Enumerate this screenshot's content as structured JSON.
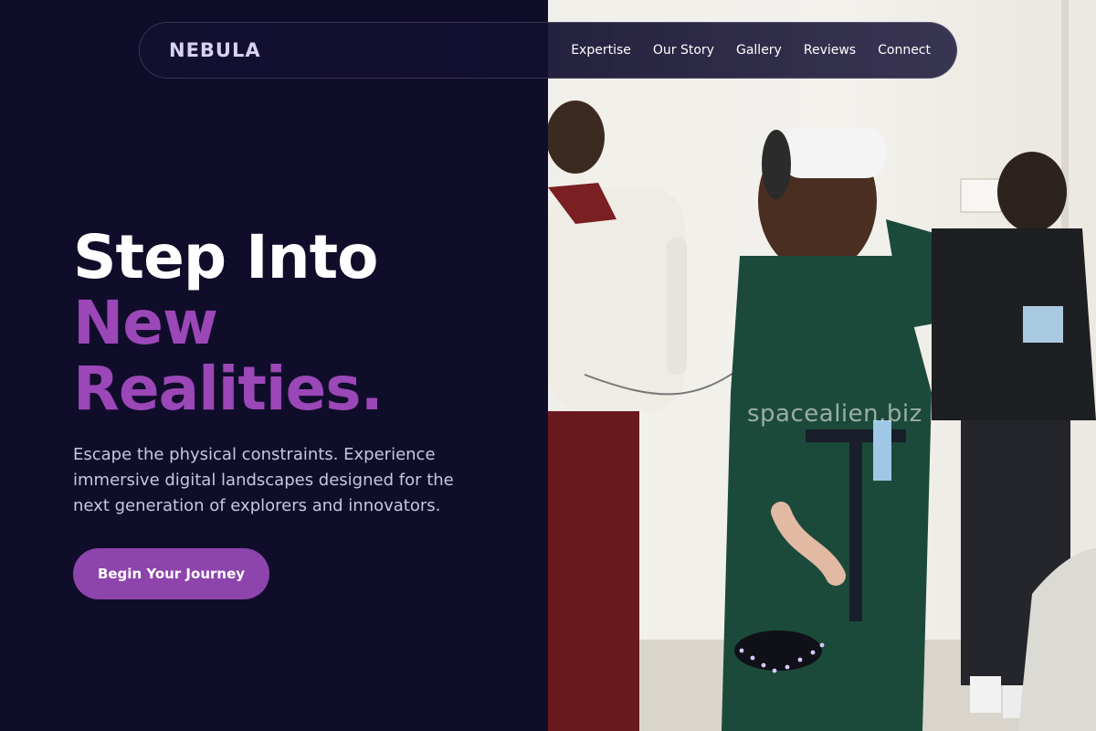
{
  "navbar": {
    "brand": "NEBULA",
    "links": [
      "Expertise",
      "Our Story",
      "Gallery",
      "Reviews",
      "Connect"
    ]
  },
  "hero": {
    "title_line1": "Step Into",
    "title_line2": "New",
    "title_line3": "Realities.",
    "description": "Escape the physical constraints. Experience immersive digital landscapes designed for the next generation of explorers and innovators.",
    "cta_label": "Begin Your Journey"
  },
  "photo": {
    "watermark": "spacealien.biz"
  },
  "colors": {
    "background": "#100d2a",
    "accent": "#8e44ad",
    "accent_text": "#9b47b8",
    "body_text": "#c5c8e0"
  }
}
